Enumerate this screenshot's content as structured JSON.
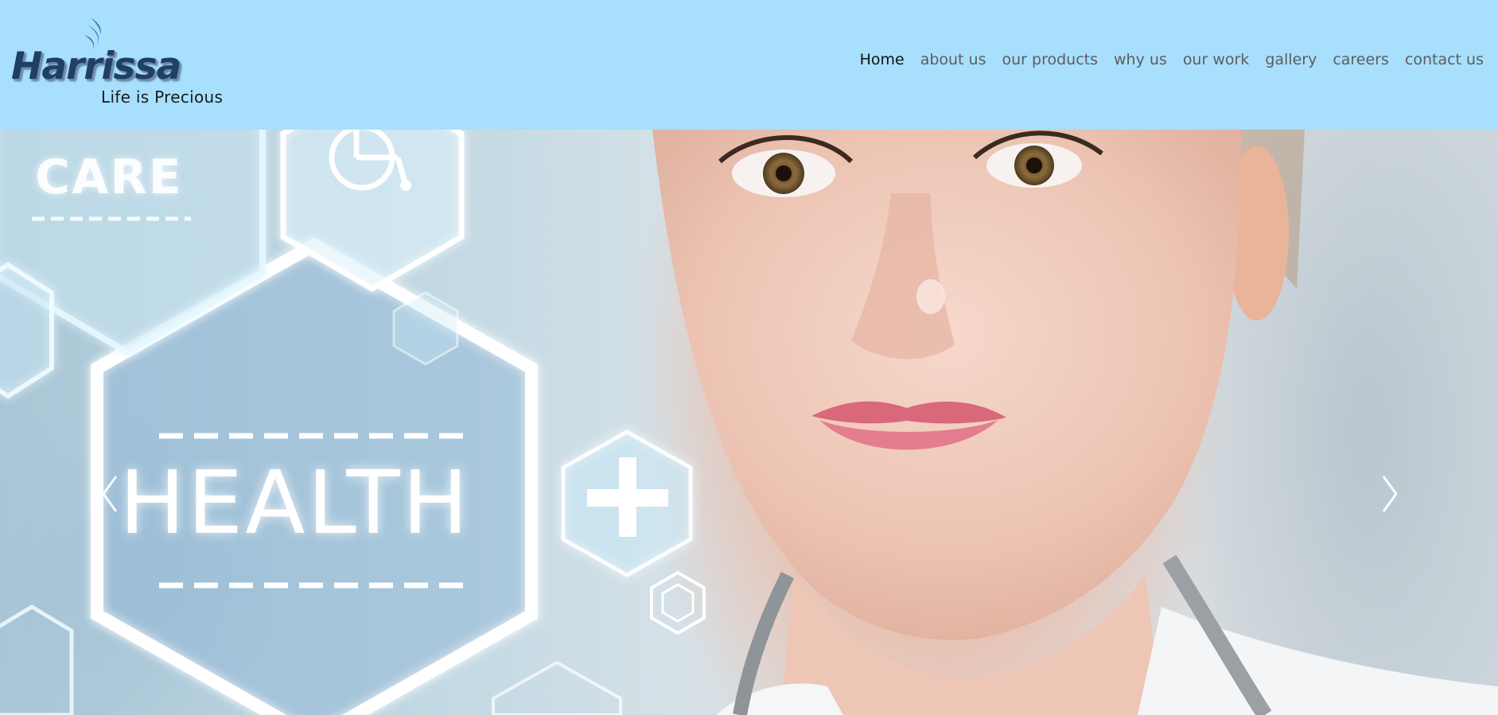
{
  "brand": {
    "name": "Harrissa",
    "tagline": "Life is Precious",
    "colors": {
      "header_bg": "#a8dffc",
      "logo_text": "#1f3f64",
      "nav_text": "#5d5d5d",
      "nav_active": "#111111"
    }
  },
  "nav": {
    "items": [
      {
        "label": "Home",
        "active": true
      },
      {
        "label": "about us",
        "active": false
      },
      {
        "label": "our products",
        "active": false
      },
      {
        "label": "why us",
        "active": false
      },
      {
        "label": "our work",
        "active": false
      },
      {
        "label": "gallery",
        "active": false
      },
      {
        "label": "careers",
        "active": false
      },
      {
        "label": "contact us",
        "active": false
      }
    ]
  },
  "hero": {
    "slide_text": {
      "health": "HEALTH",
      "care": "CARE"
    },
    "icons": [
      "wheelchair-icon",
      "plus-icon",
      "chevron-left-icon",
      "chevron-right-icon"
    ]
  }
}
